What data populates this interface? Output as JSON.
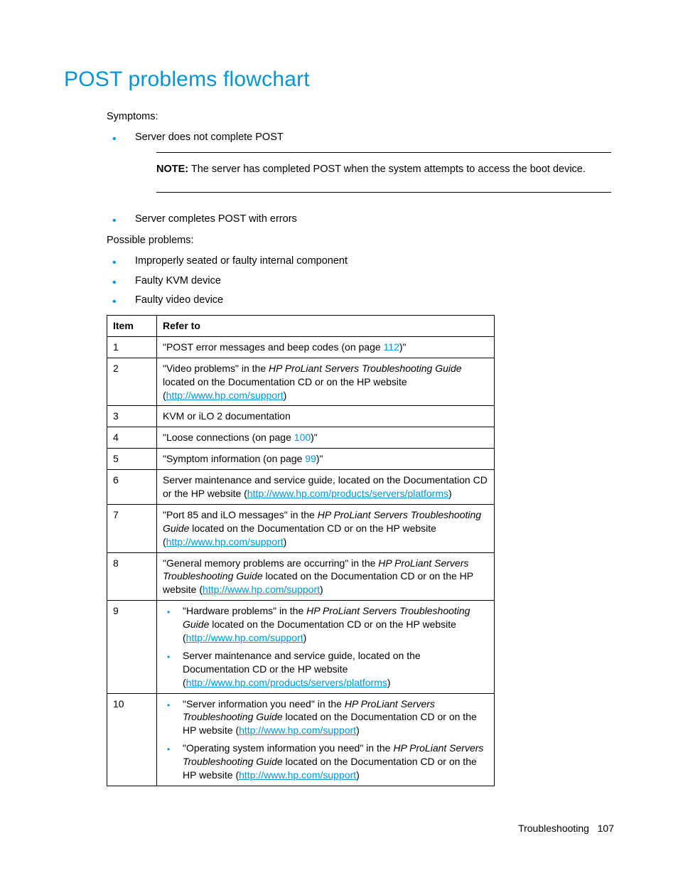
{
  "heading": "POST problems flowchart",
  "symptoms_label": "Symptoms:",
  "symptoms": [
    "Server does not complete POST",
    "Server completes POST with errors"
  ],
  "note_label": "NOTE:",
  "note_text": "  The server has completed POST when the system attempts to access the boot device.",
  "possible_label": "Possible problems:",
  "possible": [
    "Improperly seated or faulty internal component",
    "Faulty KVM device",
    "Faulty video device"
  ],
  "table": {
    "col1": "Item",
    "col2": "Refer to",
    "rows": {
      "r1": {
        "item": "1",
        "a": "\"POST error messages and beep codes (on page ",
        "page": "112",
        "c": ")\""
      },
      "r2": {
        "item": "2",
        "a": "\"Video problems\" in the ",
        "i": "HP ProLiant Servers Troubleshooting Guide",
        "b": " located on the Documentation CD or on the HP website (",
        "link": "http://www.hp.com/support",
        "c": ")"
      },
      "r3": {
        "item": "3",
        "a": "KVM or iLO 2 documentation"
      },
      "r4": {
        "item": "4",
        "a": "\"Loose connections (on page ",
        "page": "100",
        "c": ")\""
      },
      "r5": {
        "item": "5",
        "a": "\"Symptom information (on page ",
        "page": "99",
        "c": ")\""
      },
      "r6": {
        "item": "6",
        "a": "Server maintenance and service guide, located on the Documentation CD or the HP website (",
        "link": "http://www.hp.com/products/servers/platforms",
        "c": ")"
      },
      "r7": {
        "item": "7",
        "a": "\"Port 85 and iLO messages\" in the ",
        "i": "HP ProLiant Servers Troubleshooting Guide",
        "b": " located on the Documentation CD or on the HP website (",
        "link": "http://www.hp.com/support",
        "c": ")"
      },
      "r8": {
        "item": "8",
        "a": "\"General memory problems are occurring\" in the ",
        "i": "HP ProLiant Servers Troubleshooting Guide",
        "b": " located on the Documentation CD or on the HP website (",
        "link": "http://www.hp.com/support",
        "c": ")"
      },
      "r9": {
        "item": "9",
        "b1a": "\"Hardware problems\" in the ",
        "b1i": "HP ProLiant Servers Troubleshooting Guide",
        "b1b": " located on the Documentation CD or on the HP website (",
        "b1link": "http://www.hp.com/support",
        "b1c": ")",
        "b2a": "Server maintenance and service guide, located on the Documentation CD or the HP website (",
        "b2link": "http://www.hp.com/products/servers/platforms",
        "b2c": ")"
      },
      "r10": {
        "item": "10",
        "b1a": "\"Server information you need\" in the ",
        "b1i": "HP ProLiant Servers Troubleshooting Guide",
        "b1b": " located on the Documentation CD or on the HP website (",
        "b1link": "http://www.hp.com/support",
        "b1c": ")",
        "b2a": "\"Operating system information you need\" in the ",
        "b2i": "HP ProLiant Servers Troubleshooting Guide",
        "b2b": " located on the Documentation CD or on the HP website (",
        "b2link": "http://www.hp.com/support",
        "b2c": ")"
      }
    }
  },
  "footer_section": "Troubleshooting",
  "footer_page": "107"
}
